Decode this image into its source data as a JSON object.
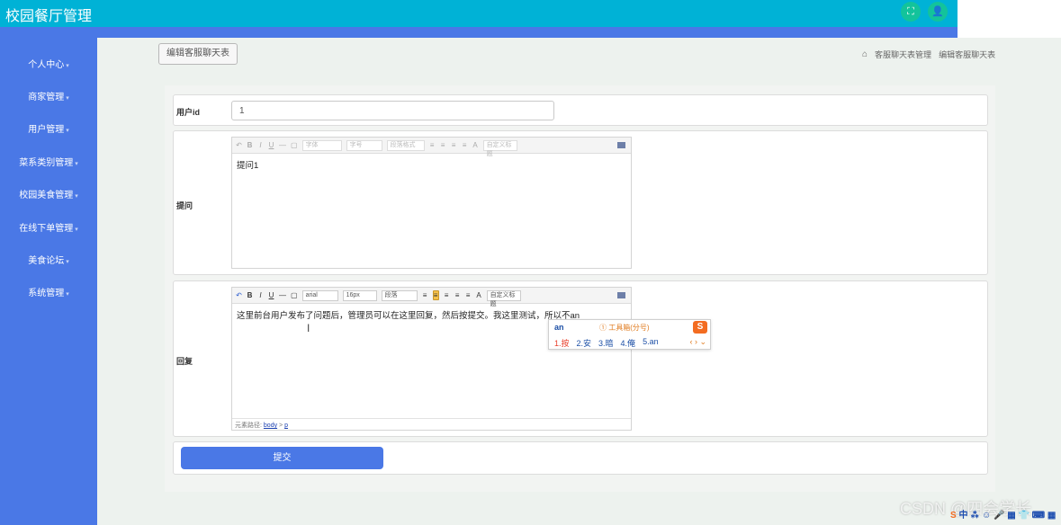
{
  "app": {
    "title": "校园餐厅管理"
  },
  "topbar": {
    "fullscreen_icon": "expand-icon",
    "user_icon": "user-icon",
    "fullscreen_glyph": "⛶",
    "user_glyph": "👤"
  },
  "sidebar": {
    "items": [
      {
        "label": "个人中心"
      },
      {
        "label": "商家管理"
      },
      {
        "label": "用户管理"
      },
      {
        "label": "菜系类别管理"
      },
      {
        "label": "校园美食管理"
      },
      {
        "label": "在线下单管理"
      },
      {
        "label": "美食论坛"
      },
      {
        "label": "系统管理"
      }
    ],
    "caret": "▾"
  },
  "header": {
    "button_label": "编辑客服聊天表",
    "breadcrumb": {
      "home_icon": "⌂",
      "level1": "客服聊天表管理",
      "level2": "编辑客服聊天表"
    }
  },
  "form": {
    "user_id": {
      "label": "用户id",
      "value": "1"
    },
    "question": {
      "label": "提问",
      "content": "提问1"
    },
    "reply": {
      "label": "回复",
      "content": "这里前台用户发布了问题后，管理员可以在这里回复，然后按提交。我这里测试，所以不an",
      "element_path_label": "元素路径:",
      "path_body": "body",
      "path_sep": " > ",
      "path_p": "p"
    },
    "toolbar": {
      "undo": "↶",
      "bold": "B",
      "italic": "I",
      "underline": "U",
      "hr": "—",
      "clear": "▢",
      "font_family": "arial",
      "font_size": "16px",
      "paragraph": "段落",
      "align_icons": [
        "≡",
        "≡",
        "≡",
        "≡",
        "≡"
      ],
      "font_color": "A",
      "custom_title": "自定义标题",
      "disabled_font_family": "字体",
      "disabled_font_size": "字号",
      "disabled_paragraph": "段落格式",
      "disabled_custom_title": "自定义标题"
    },
    "submit_label": "提交"
  },
  "ime": {
    "pinyin": "an",
    "tip": "① 工具箱(分号)",
    "logo": "S",
    "candidates": [
      "1.按",
      "2.安",
      "3.暗",
      "4.俺",
      "5.an"
    ],
    "nav": "‹ › ⌄"
  },
  "overlay": {
    "watermark": "CSDN @四会学长",
    "tray": "中 ⁂ ☺ 🎤 ▦ 👕 ⌨ ▦"
  }
}
